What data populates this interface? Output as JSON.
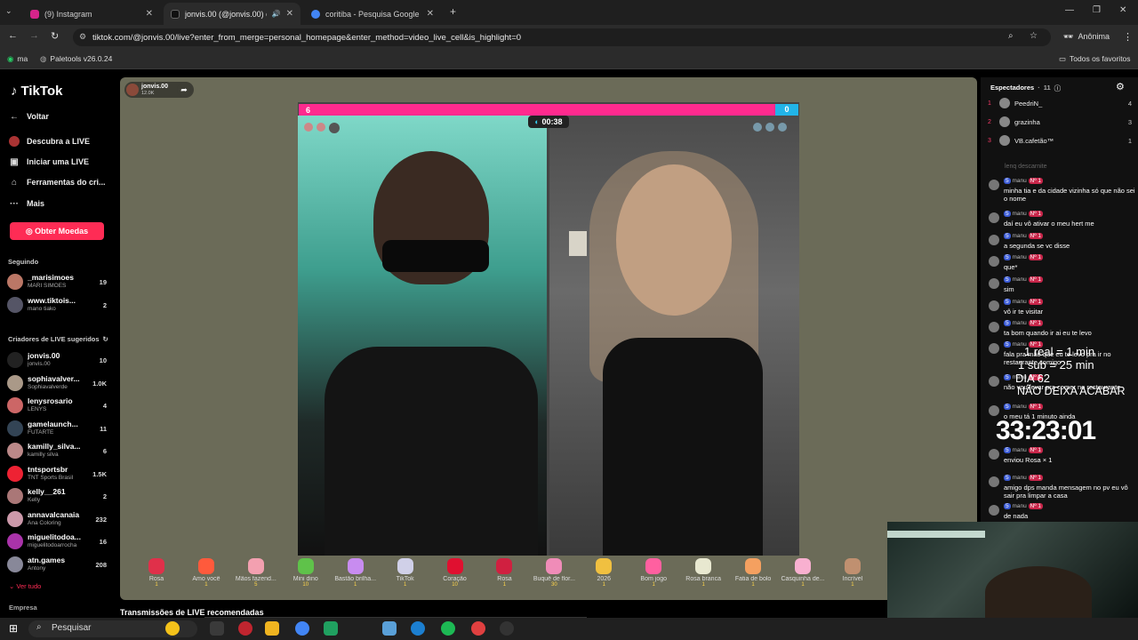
{
  "browser": {
    "tabs": [
      {
        "label": "(9) Instagram",
        "color": "#d6248a"
      },
      {
        "label": "jonvis.00 (@jonvis.00) com",
        "color": "#111111"
      },
      {
        "label": "coritiba - Pesquisa Google",
        "color": "#4285f4"
      }
    ],
    "url": "tiktok.com/@jonvis.00/live?enter_from_merge=personal_homepage&enter_method=video_live_cell&is_highlight=0",
    "profile": "Anônima",
    "bookmarks": [
      "ma",
      "Paletools v26.0.24"
    ],
    "favorites": "Todos os favoritos"
  },
  "sidebar": {
    "logo": "TikTok",
    "back": "Voltar",
    "nav": [
      "Descubra a LIVE",
      "Iniciar uma LIVE",
      "Ferramentas do cri...",
      "Mais"
    ],
    "coins": "Obter Moedas",
    "following_title": "Seguindo",
    "following": [
      {
        "name": "_marisimoes",
        "sub": "MARI SIMÕES",
        "count": "19"
      },
      {
        "name": "www.tiktois...",
        "sub": "mano tiako",
        "count": "2"
      }
    ],
    "suggested_title": "Criadores de LIVE sugeridos",
    "suggested": [
      {
        "name": "jonvis.00",
        "sub": "jonvis.00",
        "count": "10"
      },
      {
        "name": "sophiavalver...",
        "sub": "Sophiavalverde",
        "count": "1.0K"
      },
      {
        "name": "lenysrosario",
        "sub": "LENYS",
        "count": "4"
      },
      {
        "name": "gamelaunch...",
        "sub": "FUTARTE",
        "count": "11"
      },
      {
        "name": "kamilly_silva...",
        "sub": "kamilly silva",
        "count": "6"
      },
      {
        "name": "tntsportsbr",
        "sub": "TNT Sports Brasil",
        "count": "1.5K"
      },
      {
        "name": "kelly__261",
        "sub": "Kelly",
        "count": "2"
      },
      {
        "name": "annavalcanaia",
        "sub": "Ana Coloring",
        "count": "232"
      },
      {
        "name": "miguelitodoa...",
        "sub": "miguelitodoarrocha",
        "count": "16"
      },
      {
        "name": "atn.games",
        "sub": "Antony",
        "count": "208"
      }
    ],
    "see_all": "Ver tudo",
    "footer": "Empresa"
  },
  "stream": {
    "host": "jonvis.00",
    "host_viewers": "12.0K",
    "score_left": "6",
    "score_right": "0",
    "timer": "00:38",
    "recommended": "Transmissões de LIVE recomendadas"
  },
  "gifts": [
    {
      "name": "Rosa",
      "price": "1",
      "color": "#e0304a"
    },
    {
      "name": "Amo você",
      "price": "1",
      "color": "#ff5a3c"
    },
    {
      "name": "Mãos fazend...",
      "price": "5",
      "color": "#f3a0b0"
    },
    {
      "name": "Mini dino",
      "price": "10",
      "color": "#5fc24a"
    },
    {
      "name": "Bastão brilha...",
      "price": "1",
      "color": "#c88cf0"
    },
    {
      "name": "TikTok",
      "price": "1",
      "color": "#d0d0e8"
    },
    {
      "name": "Coração",
      "price": "10",
      "color": "#e01030"
    },
    {
      "name": "Rosa",
      "price": "1",
      "color": "#d02040"
    },
    {
      "name": "Buquê de flor...",
      "price": "30",
      "color": "#f08cb8"
    },
    {
      "name": "2026",
      "price": "1",
      "color": "#f0c040"
    },
    {
      "name": "Bom jogo",
      "price": "1",
      "color": "#ff60a0"
    },
    {
      "name": "Rosa branca",
      "price": "1",
      "color": "#e8e8d0"
    },
    {
      "name": "Fatia de bolo",
      "price": "1",
      "color": "#f4a060"
    },
    {
      "name": "Casquinha de...",
      "price": "1",
      "color": "#f8b0d0"
    },
    {
      "name": "Incrível",
      "price": "1",
      "color": "#c09070"
    }
  ],
  "chat": {
    "viewers_title": "Espectadores",
    "viewers_count": "11",
    "viewers": [
      {
        "rank": "1",
        "name": "PeedriN_",
        "score": "4"
      },
      {
        "rank": "2",
        "name": "grazinha",
        "score": "3"
      },
      {
        "rank": "3",
        "name": "VB.cafetão™",
        "score": "1"
      }
    ],
    "faded": "lenq descarnite",
    "messages": [
      {
        "user": "manu",
        "text": "minha tia e da cidade vizinha só que não sei o nome"
      },
      {
        "user": "manu",
        "text": "daí eu vô ativar o meu hert me"
      },
      {
        "user": "manu",
        "text": "a segunda se vc disse"
      },
      {
        "user": "manu",
        "text": "que*"
      },
      {
        "user": "manu",
        "text": "sim"
      },
      {
        "user": "manu",
        "text": "vô ir te visitar"
      },
      {
        "user": "manu",
        "text": "ta bom quando ir ai eu te levo"
      },
      {
        "user": "manu",
        "text": "fala pra mãe que eu te levo pra ir no restaurante comigo"
      },
      {
        "user": "manu",
        "text": "não vou levar pra comer no restaurante"
      },
      {
        "user": "manu",
        "text": "o meu tá 1 minuto ainda"
      },
      {
        "user": "manu",
        "text": "enviou Rosa × 1"
      },
      {
        "user": "manu",
        "text": "amigo dps manda mensagem no pv eu vô sair pra limpar a casa"
      },
      {
        "user": "manu",
        "text": "de nada"
      }
    ],
    "badge_level": "5",
    "badge_rank": "Nº 1"
  },
  "overlay": {
    "line1": "1 real = 1 min",
    "line2": "1 sub = 25 min",
    "line3": "DIA 62",
    "line4": "NÃO DEIXA ACABAR",
    "timer": "33:23:01"
  },
  "taskbar": {
    "search": "Pesquisar"
  }
}
